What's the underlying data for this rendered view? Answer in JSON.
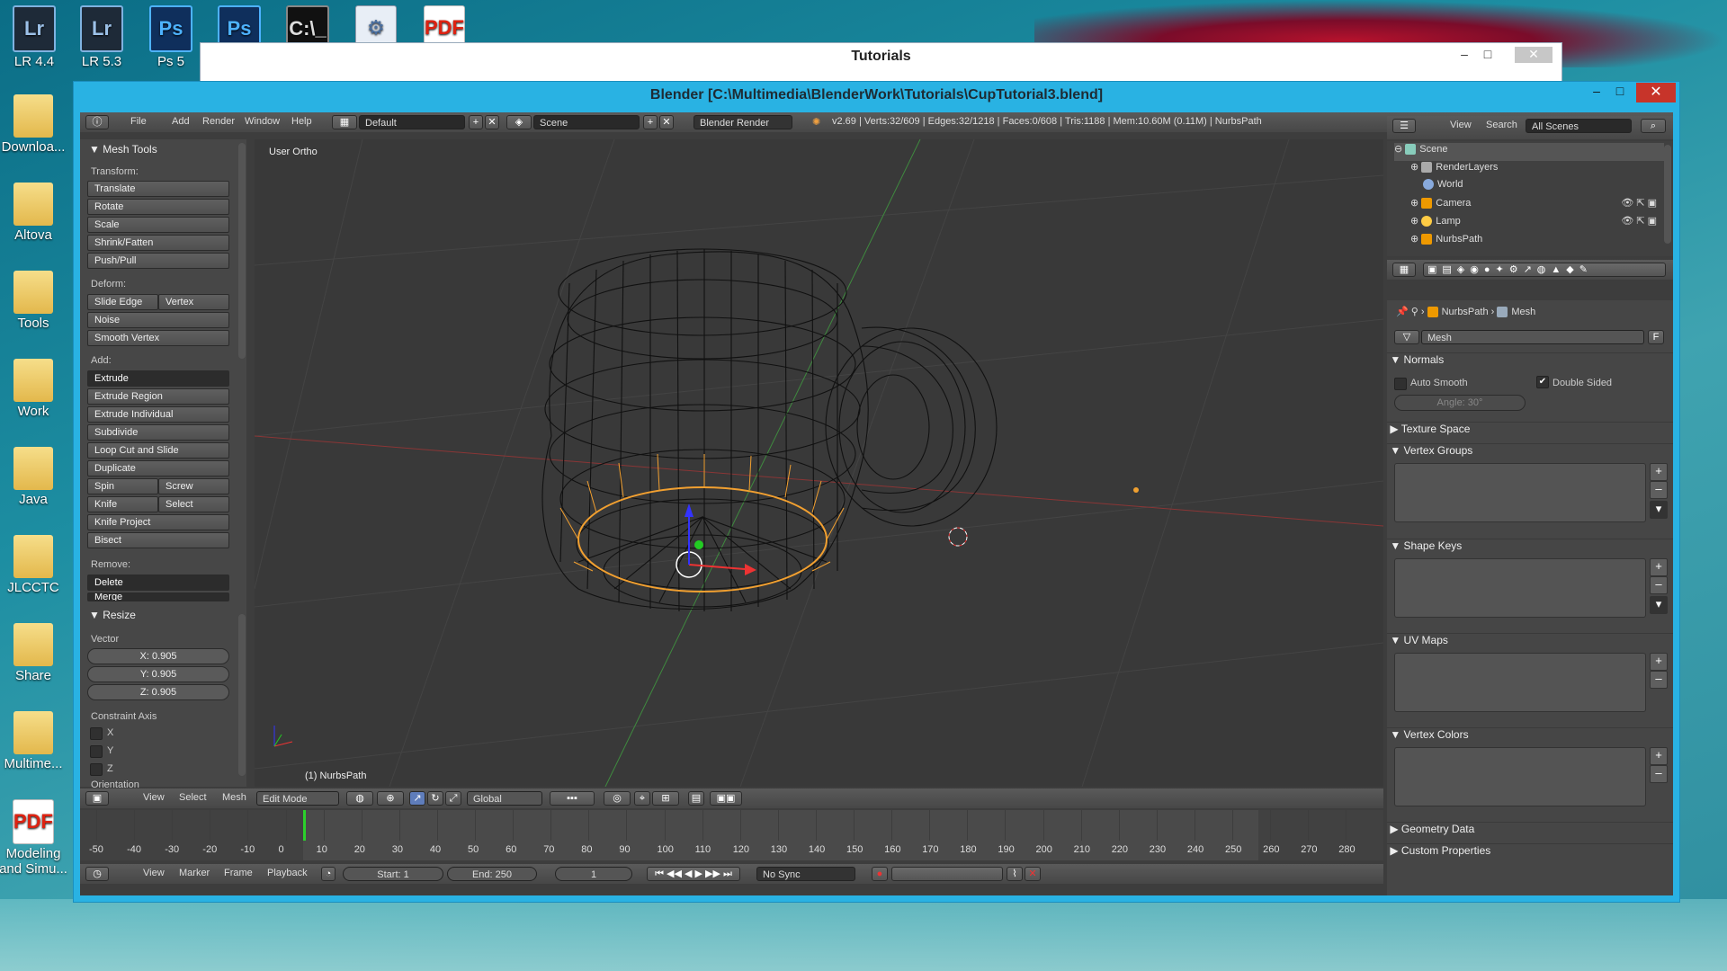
{
  "desktop": {
    "icons": [
      {
        "label": "LR 4.4",
        "glyph": "Lr"
      },
      {
        "label": "LR 5.3",
        "glyph": "Lr"
      },
      {
        "label": "Ps 5",
        "glyph": "Ps"
      },
      {
        "label": "Downloa...",
        "glyph": ""
      },
      {
        "label": "Altova",
        "glyph": ""
      },
      {
        "label": "Tools",
        "glyph": ""
      },
      {
        "label": "Work",
        "glyph": ""
      },
      {
        "label": "Java",
        "glyph": ""
      },
      {
        "label": "JLCCTC",
        "glyph": ""
      },
      {
        "label": "Share",
        "glyph": ""
      },
      {
        "label": "Multime...",
        "glyph": ""
      },
      {
        "label": "Modeling and Simu...",
        "glyph": ""
      }
    ],
    "top_icons": [
      {
        "glyph": "Ps"
      },
      {
        "glyph": "C:\\_"
      },
      {
        "glyph": "PDF"
      }
    ]
  },
  "explorer": {
    "title": "Tutorials"
  },
  "blender": {
    "title": "Blender [C:\\Multimedia\\BlenderWork\\Tutorials\\CupTutorial3.blend]",
    "menu": [
      "File",
      "Add",
      "Render",
      "Window",
      "Help"
    ],
    "layout": "Default",
    "scene": "Scene",
    "engine": "Blender Render",
    "stats": "v2.69 | Verts:32/609 | Edges:32/1218 | Faces:0/608 | Tris:1188 | Mem:10.60M (0.11M) | NurbsPath",
    "toolshelf": {
      "title": "Mesh Tools",
      "transform_label": "Transform:",
      "transform": [
        "Translate",
        "Rotate",
        "Scale",
        "Shrink/Fatten",
        "Push/Pull"
      ],
      "deform_label": "Deform:",
      "slide_edge": "Slide Edge",
      "vertex": "Vertex",
      "noise": "Noise",
      "smooth_vertex": "Smooth Vertex",
      "add_label": "Add:",
      "extrude": "Extrude",
      "extrude_region": "Extrude Region",
      "extrude_individual": "Extrude Individual",
      "subdivide": "Subdivide",
      "loop_cut": "Loop Cut and Slide",
      "duplicate": "Duplicate",
      "spin": "Spin",
      "screw": "Screw",
      "knife": "Knife",
      "select": "Select",
      "knife_project": "Knife Project",
      "bisect": "Bisect",
      "remove_label": "Remove:",
      "delete": "Delete",
      "merge": "Merge"
    },
    "operator": {
      "title": "Resize",
      "vector_label": "Vector",
      "x": "X: 0.905",
      "y": "Y: 0.905",
      "z": "Z: 0.905",
      "constraint_label": "Constraint Axis",
      "cx": "X",
      "cy": "Y",
      "cz": "Z",
      "orientation_label": "Orientation"
    },
    "viewport": {
      "view_label": "User Ortho",
      "object_label": "(1) NurbsPath"
    },
    "view_header": {
      "items": [
        "View",
        "Select",
        "Mesh"
      ],
      "mode": "Edit Mode",
      "orientation": "Global"
    },
    "timeline": {
      "ticks": [
        "-50",
        "-40",
        "-30",
        "-20",
        "-10",
        "0",
        "10",
        "20",
        "30",
        "40",
        "50",
        "60",
        "70",
        "80",
        "90",
        "100",
        "110",
        "120",
        "130",
        "140",
        "150",
        "160",
        "170",
        "180",
        "190",
        "200",
        "210",
        "220",
        "230",
        "240",
        "250",
        "260",
        "270",
        "280"
      ],
      "items": [
        "View",
        "Marker",
        "Frame",
        "Playback"
      ],
      "start": "Start: 1",
      "end": "End: 250",
      "current": "1",
      "sync": "No Sync"
    },
    "outliner": {
      "items": [
        "View",
        "Search"
      ],
      "filter": "All Scenes",
      "rows": [
        "Scene",
        "RenderLayers",
        "World",
        "Camera",
        "Lamp",
        "NurbsPath"
      ]
    },
    "properties": {
      "breadcrumb_obj": "NurbsPath",
      "breadcrumb_data": "Mesh",
      "datablock": "Mesh",
      "fake_user": "F",
      "normals": "Normals",
      "auto_smooth": "Auto Smooth",
      "double_sided": "Double Sided",
      "angle": "Angle: 30°",
      "texture_space": "Texture Space",
      "vertex_groups": "Vertex Groups",
      "shape_keys": "Shape Keys",
      "uv_maps": "UV Maps",
      "vertex_colors": "Vertex Colors",
      "geometry_data": "Geometry Data",
      "custom_properties": "Custom Properties"
    }
  }
}
